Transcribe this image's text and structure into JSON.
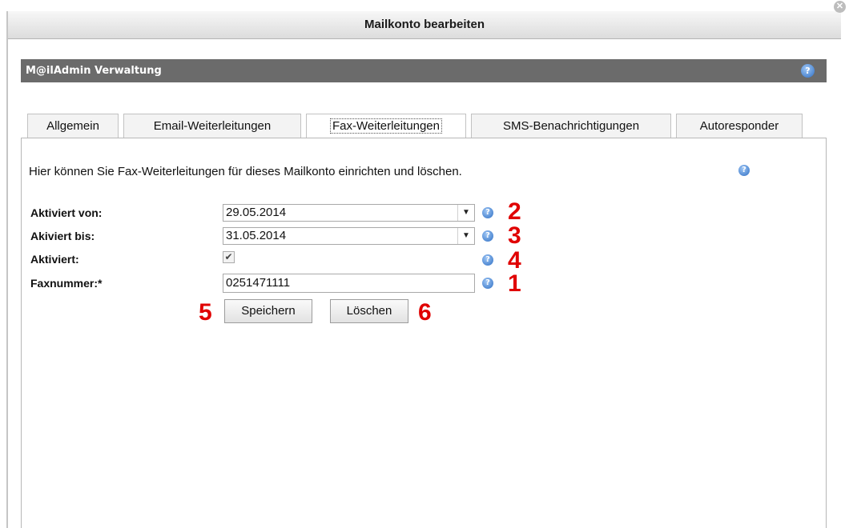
{
  "dialog": {
    "title": "Mailkonto bearbeiten",
    "close_icon": "close-circle-icon"
  },
  "panel": {
    "title": "M@ilAdmin Verwaltung",
    "help_icon": "help-icon",
    "help_glyph": "?"
  },
  "tabs": [
    {
      "label": "Allgemein",
      "active": false
    },
    {
      "label": "Email-Weiterleitungen",
      "active": false
    },
    {
      "label": "Fax-Weiterleitungen",
      "active": true
    },
    {
      "label": "SMS-Benachrichtigungen",
      "active": false
    },
    {
      "label": "Autoresponder",
      "active": false
    }
  ],
  "form": {
    "intro_text": "Hier können Sie Fax-Weiterleitungen für dieses Mailkonto einrichten und löschen.",
    "activated_from": {
      "label": "Aktiviert von:",
      "value": "29.05.2014"
    },
    "activated_until": {
      "label": "Akiviert bis:",
      "value": "31.05.2014"
    },
    "activated": {
      "label": "Aktiviert:",
      "checked": true
    },
    "fax_number": {
      "label": "Faxnummer:*",
      "value": "0251471111"
    },
    "save_label": "Speichern",
    "delete_label": "Löschen"
  },
  "annotations": {
    "n1": "1",
    "n2": "2",
    "n3": "3",
    "n4": "4",
    "n5": "5",
    "n6": "6"
  },
  "colors": {
    "panel_bar": "#6b6b6b",
    "annotation_red": "#e00000",
    "help_blue": "#2f6fc4"
  }
}
